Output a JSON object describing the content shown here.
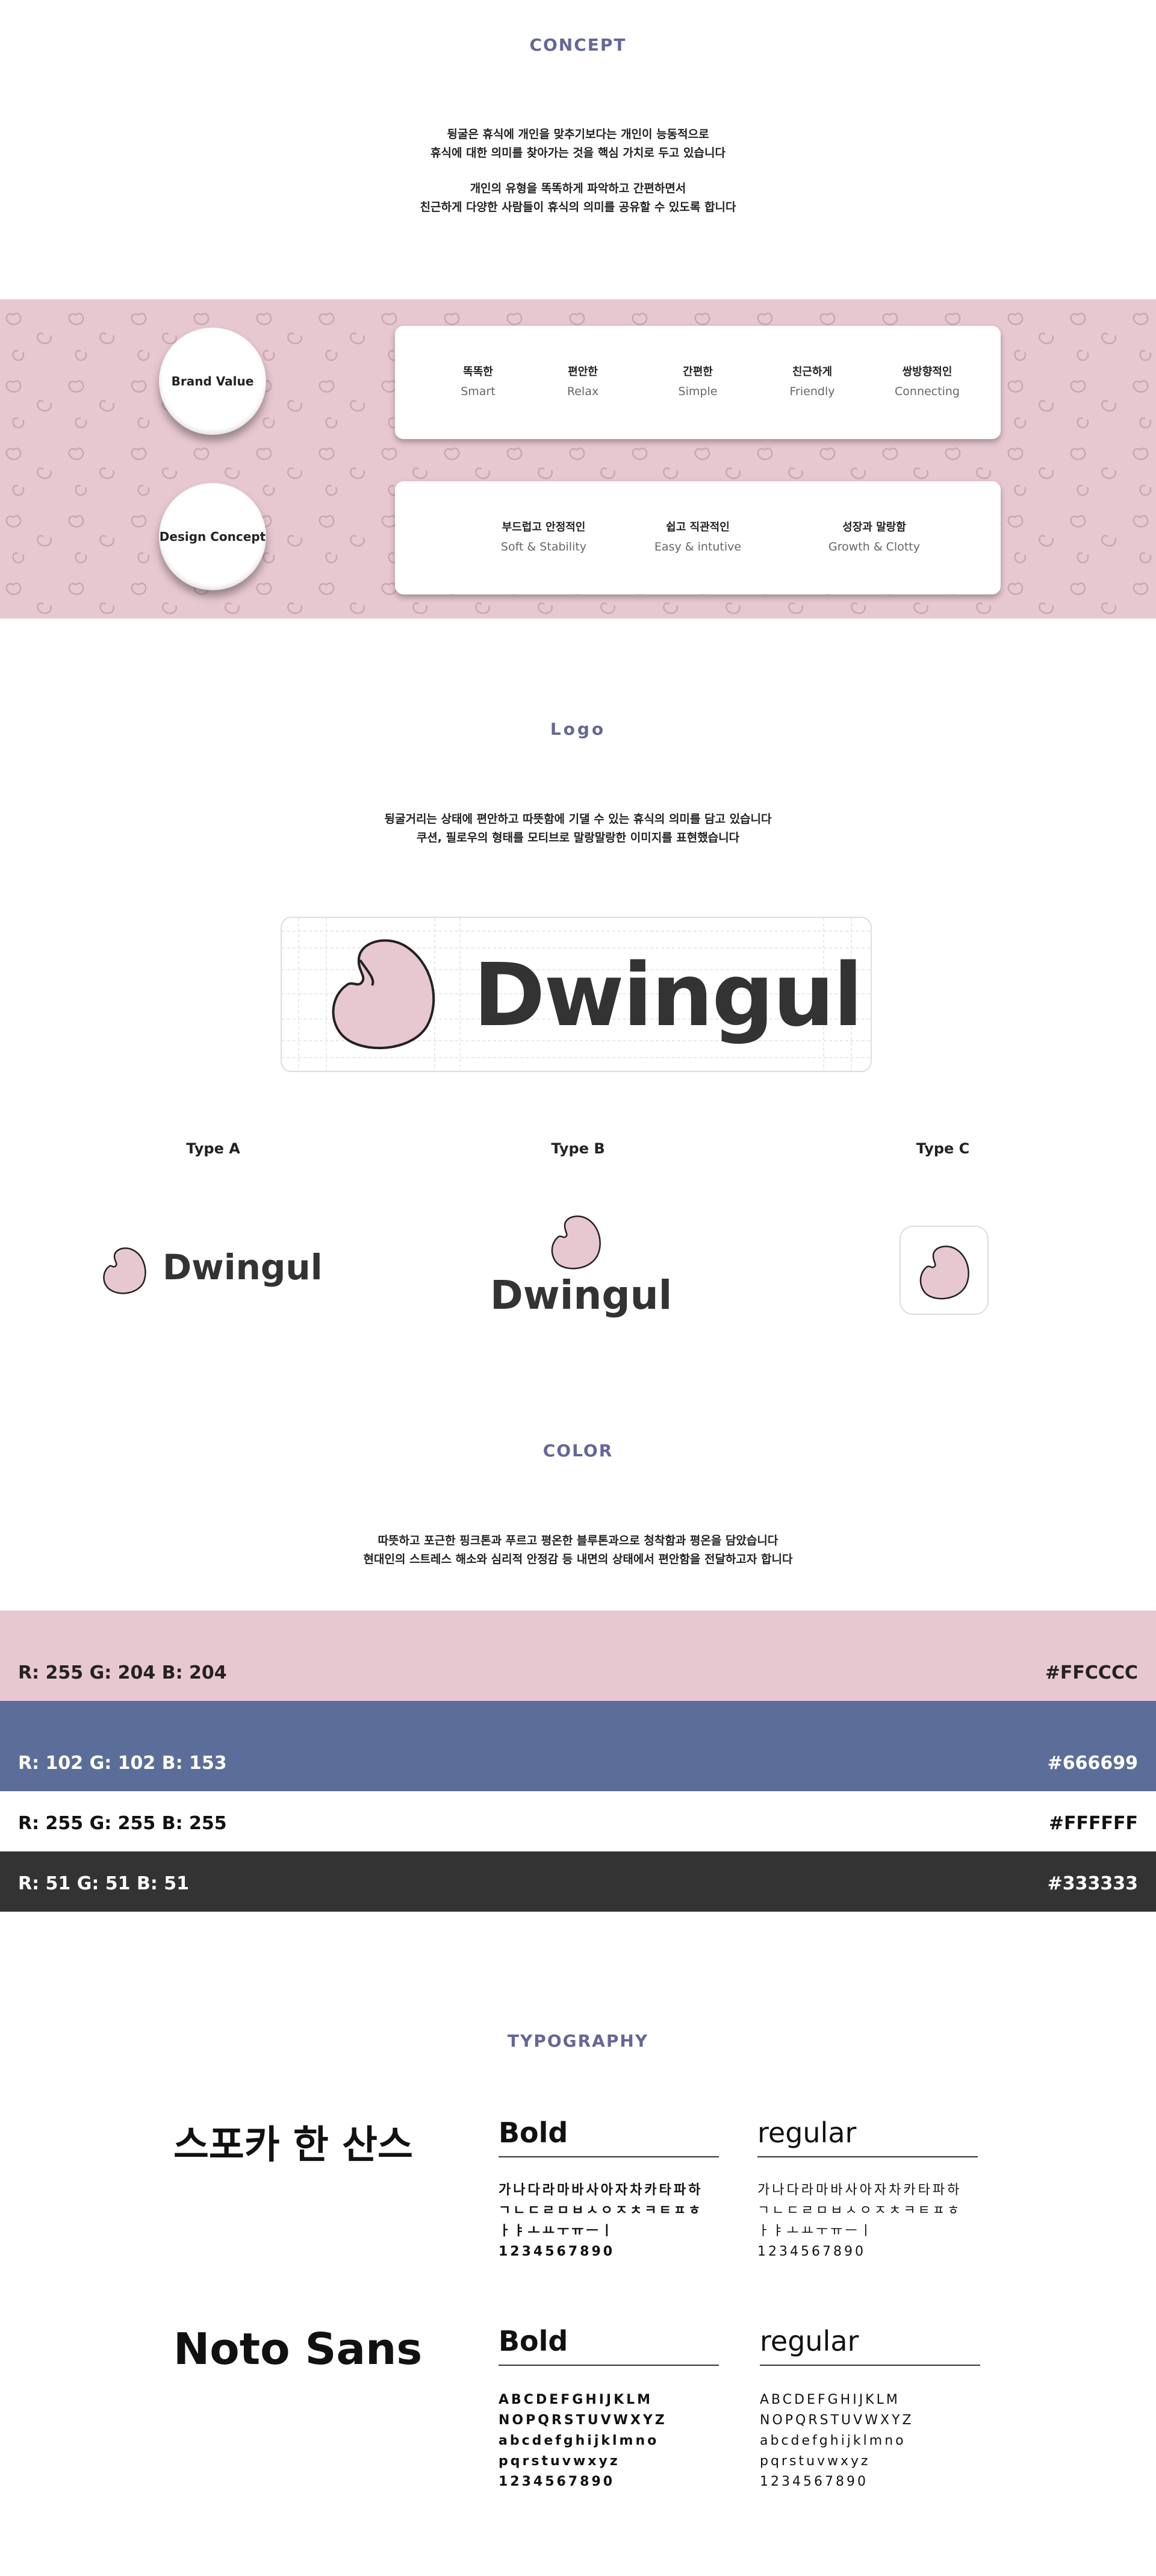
{
  "concept": {
    "title": "CONCEPT",
    "lines": [
      "뒹굴은 휴식에 개인을 맞추기보다는 개인이 능동적으로",
      "휴식에 대한 의미를 찾아가는 것을 핵심 가치로 두고 있습니다",
      "",
      "개인의 유형을 똑똑하게 파악하고 간편하면서",
      "친근하게 다양한 사람들이 휴식의 의미를 공유할 수 있도록 합니다"
    ],
    "brand_value": {
      "label": "Brand Value",
      "items": [
        {
          "ko": "똑똑한",
          "en": "Smart"
        },
        {
          "ko": "편안한",
          "en": "Relax"
        },
        {
          "ko": "간편한",
          "en": "Simple"
        },
        {
          "ko": "친근하게",
          "en": "Friendly"
        },
        {
          "ko": "쌍방향적인",
          "en": "Connecting"
        }
      ]
    },
    "design_concept": {
      "label": "Design Concept",
      "items": [
        {
          "ko": "부드럽고 안정적인",
          "en": "Soft & Stability"
        },
        {
          "ko": "쉽고 직관적인",
          "en": "Easy & intutive"
        },
        {
          "ko": "성장과 말랑함",
          "en": "Growth & Clotty"
        }
      ]
    }
  },
  "logo": {
    "title": "Logo",
    "lines": [
      "뒹굴거리는 상태에 편안하고 따뜻함에 기댈 수 있는 휴식의 의미를 담고 있습니다",
      "쿠션, 필로우의 형태를 모티브로 말랑말랑한 이미지를 표현했습니다"
    ],
    "wordmark": "Dwingul",
    "types": [
      {
        "label": "Type A",
        "wordmark": "Dwingul"
      },
      {
        "label": "Type B",
        "wordmark": "Dwingul"
      },
      {
        "label": "Type C"
      }
    ],
    "brand_pink": "#E8C8D0"
  },
  "color": {
    "title": "COLOR",
    "lines": [
      "따뜻하고 포근한 핑크톤과 푸르고 평온한 블루톤과으로 청착함과 평온을 담았습니다",
      "현대인의 스트레스 해소와 심리적 안정감 등 내면의 상태에서 편안함을 전달하고자 합니다"
    ],
    "swatches": [
      {
        "rgb": "R: 255 G: 204 B: 204",
        "hex": "#FFCCCC",
        "display": "#E8C8D0",
        "text": "#222222"
      },
      {
        "rgb": "R: 102 G: 102 B: 153",
        "hex": "#666699",
        "display": "#5B6E99",
        "text": "#FFFFFF"
      },
      {
        "rgb": "R: 255 G: 255 B: 255",
        "hex": "#FFFFFF",
        "display": "#FFFFFF",
        "text": "#111111"
      },
      {
        "rgb": "R: 51 G: 51 B: 51",
        "hex": "#333333",
        "display": "#333333",
        "text": "#FFFFFF"
      }
    ]
  },
  "typography": {
    "title": "TYPOGRAPHY",
    "fonts": [
      {
        "name": "스포카 한 산스",
        "bold_label": "Bold",
        "regular_label": "regular",
        "glyphs": "가나다라마바사아자차카타파하\nㄱㄴㄷㄹㅁㅂㅅㅇㅈㅊㅋㅌㅍㅎ\nㅏㅑㅗㅛㅜㅠㅡㅣ\n1234567890"
      },
      {
        "name": "Noto Sans",
        "bold_label": "Bold",
        "regular_label": "regular",
        "glyphs": "ABCDEFGHIJKLM\nNOPQRSTUVWXYZ\nabcdefghijklmno\npqrstuvwxyz\n1234567890"
      }
    ]
  }
}
